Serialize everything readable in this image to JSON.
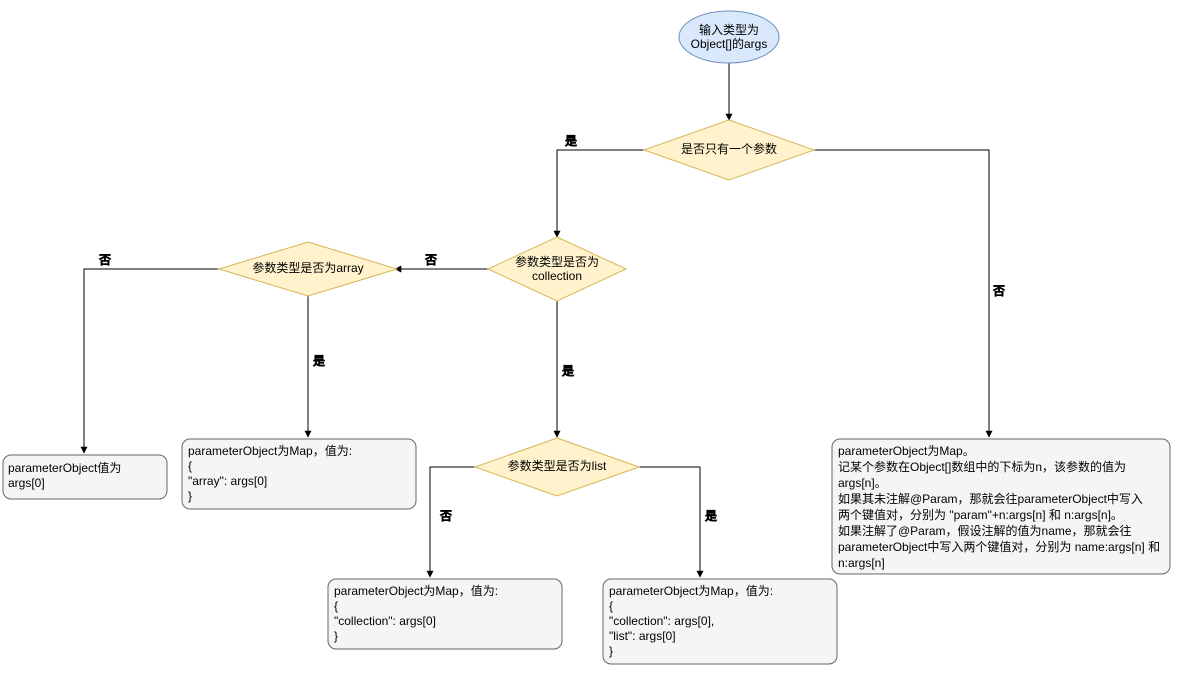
{
  "start": {
    "line1": "输入类型为",
    "line2": "Object[]的args"
  },
  "decisions": {
    "d1": "是否只有一个参数",
    "d2": {
      "line1": "参数类型是否为",
      "line2": "collection"
    },
    "d3": "参数类型是否为array",
    "d4": "参数类型是否为list"
  },
  "labels": {
    "yes": "是",
    "no": "否"
  },
  "terminals": {
    "t_args0": {
      "line1": "parameterObject值为",
      "line2": "args[0]"
    },
    "t_array": {
      "l1": "parameterObject为Map，值为:",
      "l2": "{",
      "l3": "    \"array\": args[0]",
      "l4": "}"
    },
    "t_collection": {
      "l1": "parameterObject为Map，值为:",
      "l2": "{",
      "l3": "    \"collection\": args[0]",
      "l4": "}"
    },
    "t_list": {
      "l1": "parameterObject为Map，值为:",
      "l2": "{",
      "l3": "    \"collection\": args[0],",
      "l4": "    \"list\": args[0]",
      "l5": "}"
    },
    "t_multi": {
      "l1": "parameterObject为Map。",
      "l2": "    记某个参数在Object[]数组中的下标为n，该参数的值为",
      "l3": "args[n]。",
      "l4": "    如果其未注解@Param，那就会往parameterObject中写入",
      "l5": "两个键值对，分别为 \"param\"+n:args[n] 和 n:args[n]。",
      "l6": "    如果注解了@Param，假设注解的值为name，那就会往",
      "l7": "parameterObject中写入两个键值对，分别为 name:args[n] 和",
      "l8": "n:args[n]"
    }
  }
}
